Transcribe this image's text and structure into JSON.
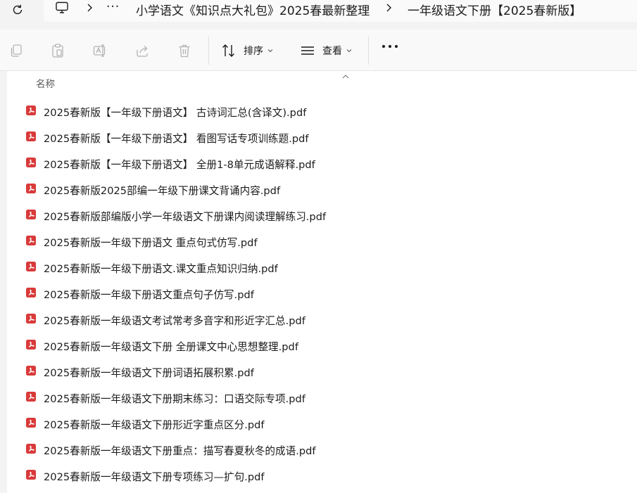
{
  "address_bar": {
    "overflow_glyph": "···",
    "crumbs": [
      "小学语文《知识点大礼包》2025春最新整理",
      "一年级语文下册【2025春新版】"
    ]
  },
  "toolbar": {
    "sort_label": "排序",
    "view_label": "查看",
    "more_label": "···"
  },
  "list": {
    "column_name": "名称",
    "files": [
      "2025春新版【一年级下册语文】 古诗词汇总(含译文).pdf",
      "2025春新版【一年级下册语文】 看图写话专项训练题.pdf",
      "2025春新版【一年级下册语文】 全册1-8单元成语解释.pdf",
      "2025春新版2025部编一年级下册课文背诵内容.pdf",
      "2025春新版部编版小学一年级语文下册课内阅读理解练习.pdf",
      "2025春新版一年级下册语文 重点句式仿写.pdf",
      "2025春新版一年级下册语文.课文重点知识归纳.pdf",
      "2025春新版一年级下册语文重点句子仿写.pdf",
      "2025春新版一年级语文考试常考多音字和形近字汇总.pdf",
      "2025春新版一年级语文下册 全册课文中心思想整理.pdf",
      "2025春新版一年级语文下册词语拓展积累.pdf",
      "2025春新版一年级语文下册期末练习：口语交际专项.pdf",
      "2025春新版一年级语文下册形近字重点区分.pdf",
      "2025春新版一年级语文下册重点：描写春夏秋冬的成语.pdf",
      "2025春新版一年级语文下册专项练习—扩句.pdf"
    ]
  },
  "colors": {
    "pdf_red": "#d93a3a",
    "toolbar_bg": "#f9f9f9",
    "address_bg": "#f3f3f3"
  },
  "icons": {
    "refresh": "refresh-icon",
    "computer": "monitor-icon",
    "copy": "copy-icon",
    "paste": "paste-icon",
    "rename": "rename-icon",
    "share": "share-icon",
    "delete": "trash-icon",
    "sort": "sort-icon",
    "view": "view-icon",
    "file": "pdf-file-icon"
  }
}
